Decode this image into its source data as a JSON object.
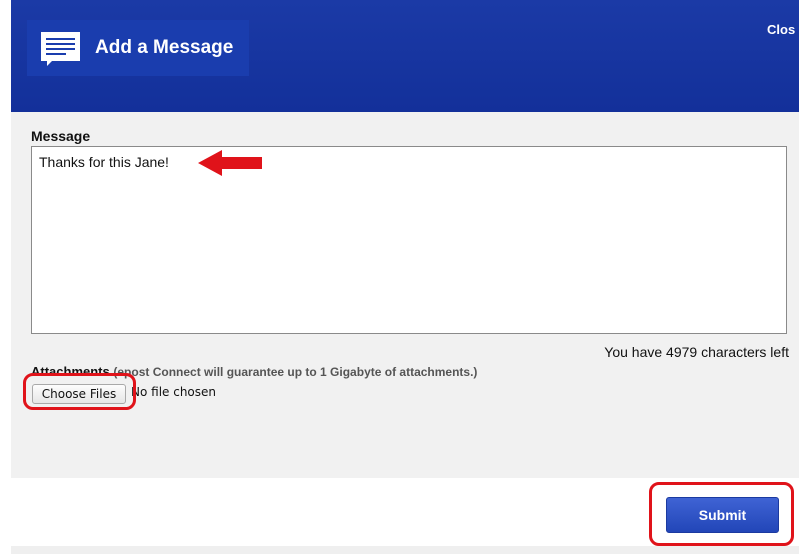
{
  "header": {
    "title": "Add a Message",
    "close_label": "Clos",
    "background_color": "#13309a"
  },
  "message": {
    "label": "Message",
    "value": "Thanks for this Jane!",
    "chars_left_text": "You have 4979 characters left"
  },
  "attachments": {
    "label": "Attachments",
    "note": "(epost Connect will guarantee up to 1 Gigabyte of attachments.)",
    "choose_files_label": "Choose Files",
    "status_text": "No file chosen"
  },
  "actions": {
    "submit_label": "Submit",
    "submit_color": "#2a4fc4"
  },
  "annotations": {
    "color": "#e0131a"
  }
}
